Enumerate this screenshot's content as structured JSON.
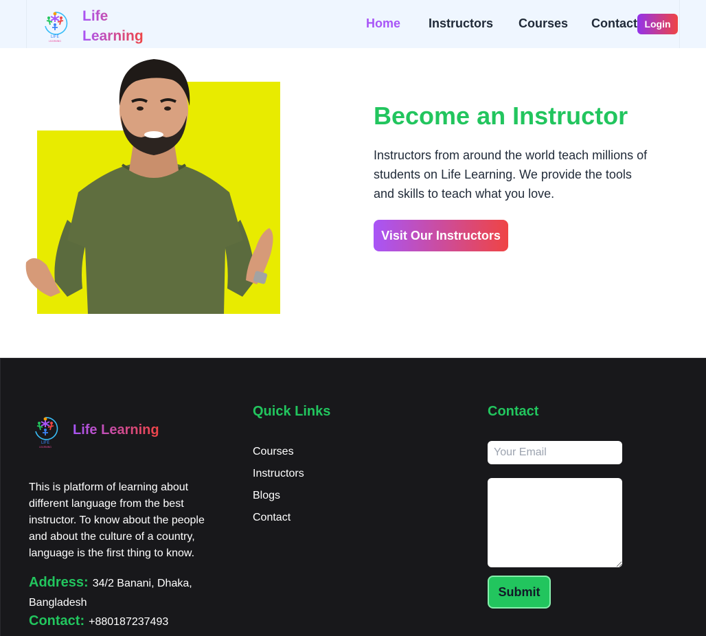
{
  "navbar": {
    "brand_line1": "Life",
    "brand_line2": "Learning",
    "links": [
      {
        "label": "Home",
        "active": true
      },
      {
        "label": "Instructors",
        "active": false
      },
      {
        "label": "Courses",
        "active": false
      },
      {
        "label": "Contact",
        "active": false
      }
    ],
    "login_label": "Login"
  },
  "hero": {
    "title": "Become an Instructor",
    "description": "Instructors from around the world teach millions of students on Life Learning. We provide the tools and skills to teach what you love.",
    "button_label": "Visit Our Instructors"
  },
  "footer": {
    "brand": "Life Learning",
    "about": "This is platform of learning about different language from the best instructor. To know about the people and about the culture of a country, language is the first thing to know.",
    "address_label": "Address:",
    "address_value": "34/2 Banani, Dhaka, Bangladesh",
    "contact_label": "Contact:",
    "contact_value": "+880187237493",
    "quick_links_heading": "Quick Links",
    "quick_links": [
      "Courses",
      "Instructors",
      "Blogs",
      "Contact"
    ],
    "contact_heading": "Contact",
    "email_placeholder": "Your Email",
    "submit_label": "Submit"
  },
  "colors": {
    "accent_green": "#22c55e",
    "gradient_start": "#a855f7",
    "gradient_end": "#ef4444",
    "footer_bg": "#18181b",
    "navbar_bg": "#eff6ff",
    "hero_backdrop_yellow": "#e8eb00"
  },
  "icons": {
    "brand_logo": "people-circle-logo-icon"
  }
}
